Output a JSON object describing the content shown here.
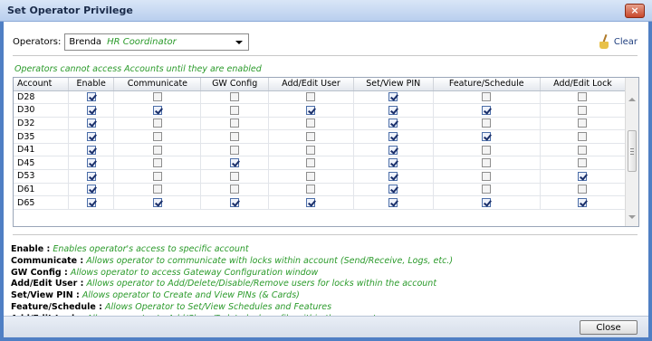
{
  "window": {
    "title": "Set Operator Privilege",
    "close_glyph": "×"
  },
  "operators": {
    "label": "Operators:",
    "selected_name": "Brenda",
    "selected_role": "HR Coordinator"
  },
  "clear": {
    "label": "Clear",
    "icon": "broom-icon"
  },
  "notice": "Operators cannot access Accounts until they are enabled",
  "grid": {
    "columns": [
      "Account",
      "Enable",
      "Communicate",
      "GW Config",
      "Add/Edit User",
      "Set/View PIN",
      "Feature/Schedule",
      "Add/Edit Lock"
    ],
    "rows": [
      {
        "account": "D28",
        "flags": [
          true,
          false,
          false,
          false,
          true,
          false,
          false
        ]
      },
      {
        "account": "D30",
        "flags": [
          true,
          true,
          false,
          true,
          true,
          true,
          false
        ]
      },
      {
        "account": "D32",
        "flags": [
          true,
          false,
          false,
          false,
          true,
          false,
          false
        ]
      },
      {
        "account": "D35",
        "flags": [
          true,
          false,
          false,
          false,
          true,
          true,
          false
        ]
      },
      {
        "account": "D41",
        "flags": [
          true,
          false,
          false,
          false,
          true,
          false,
          false
        ]
      },
      {
        "account": "D45",
        "flags": [
          true,
          false,
          true,
          false,
          true,
          false,
          false
        ]
      },
      {
        "account": "D53",
        "flags": [
          true,
          false,
          false,
          false,
          true,
          false,
          true
        ]
      },
      {
        "account": "D61",
        "flags": [
          true,
          false,
          false,
          false,
          true,
          false,
          false
        ]
      },
      {
        "account": "D65",
        "flags": [
          true,
          true,
          true,
          true,
          true,
          true,
          true
        ]
      }
    ]
  },
  "legend": [
    {
      "term": "Enable :",
      "desc": "Enables operator's access to specific account"
    },
    {
      "term": "Communicate :",
      "desc": "Allows operator to communicate with locks within account (Send/Receive, Logs, etc.)"
    },
    {
      "term": "GW Config :",
      "desc": "Allows operator to access Gateway Configuration window"
    },
    {
      "term": "Add/Edit User :",
      "desc": "Allows operator to Add/Delete/Disable/Remove users for locks within the account"
    },
    {
      "term": "Set/View PIN :",
      "desc": "Allows operator to Create and View PINs (& Cards)"
    },
    {
      "term": "Feature/Schedule :",
      "desc": "Allows Operator to Set/View Schedules and Features"
    },
    {
      "term": "Add/Edit Lock :",
      "desc": "Allows operator to Add/Clone/Delete lock profile within the account"
    }
  ],
  "footer": {
    "close_label": "Close"
  }
}
